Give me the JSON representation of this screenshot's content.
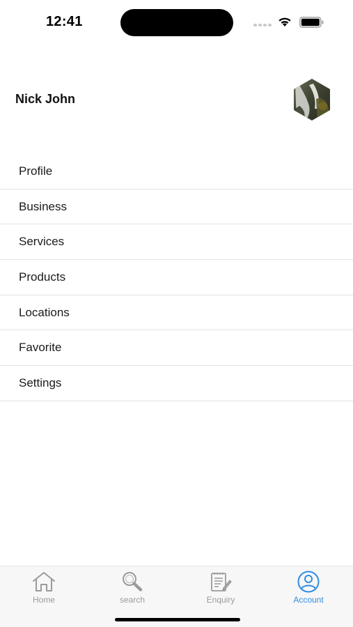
{
  "status_bar": {
    "time": "12:41",
    "icons": [
      "signal-dots-icon",
      "wifi-icon",
      "battery-icon"
    ]
  },
  "header": {
    "user_name": "Nick John",
    "avatar": "avatar-image"
  },
  "menu": {
    "items": [
      {
        "label": "Profile"
      },
      {
        "label": "Business"
      },
      {
        "label": "Services"
      },
      {
        "label": "Products"
      },
      {
        "label": "Locations"
      },
      {
        "label": "Favorite"
      },
      {
        "label": "Settings"
      }
    ]
  },
  "tab_bar": {
    "tabs": [
      {
        "label": "Home",
        "icon": "home-icon",
        "active": false
      },
      {
        "label": "search",
        "icon": "search-icon",
        "active": false
      },
      {
        "label": "Enquiry",
        "icon": "enquiry-icon",
        "active": false
      },
      {
        "label": "Account",
        "icon": "account-icon",
        "active": true
      }
    ]
  },
  "colors": {
    "accent": "#2f8de4",
    "inactive": "#9a9a9a",
    "divider": "#e3e3e3"
  }
}
